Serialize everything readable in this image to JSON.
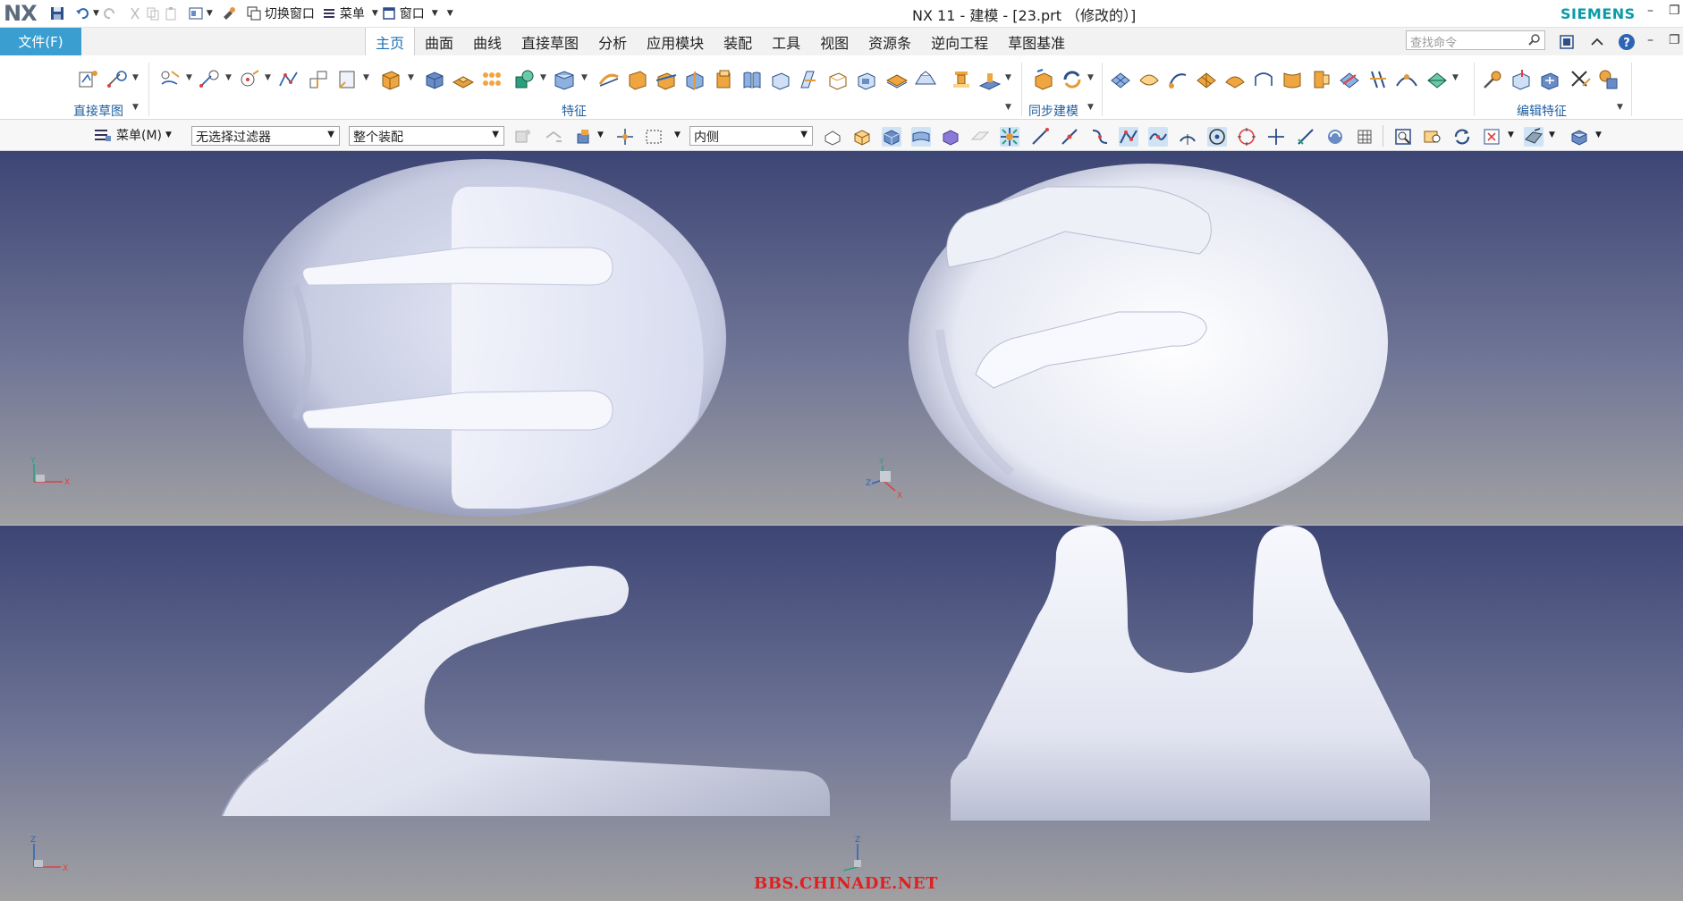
{
  "app": {
    "logo": "NX",
    "title": "NX 11 - 建模 - [23.prt （修改的）]",
    "brand": "SIEMENS",
    "quick_access": {
      "switch_window": "切换窗口",
      "menu": "菜单",
      "window": "窗口"
    }
  },
  "ribbon_tabs": {
    "file": "文件(F)",
    "tabs": [
      "主页",
      "曲面",
      "曲线",
      "直接草图",
      "分析",
      "应用模块",
      "装配",
      "工具",
      "视图",
      "资源条",
      "逆向工程",
      "草图基准"
    ],
    "active_index": 0,
    "search_placeholder": "查找命令"
  },
  "ribbon_groups": {
    "direct_sketch": "直接草图",
    "feature": "特征",
    "sync_modeling": "同步建模",
    "edit_feature": "编辑特征"
  },
  "selection_bar": {
    "menu_label": "菜单(M)",
    "filter": "无选择过滤器",
    "scope": "整个装配",
    "location": "内侧"
  },
  "viewports": {
    "axis_x": "X",
    "axis_y": "Y",
    "axis_z": "Z"
  },
  "watermark": "BBS.CHINADE.NET",
  "colors": {
    "accent": "#3a9fd0",
    "brand": "#0b9aa8",
    "watermark": "#e02020"
  }
}
